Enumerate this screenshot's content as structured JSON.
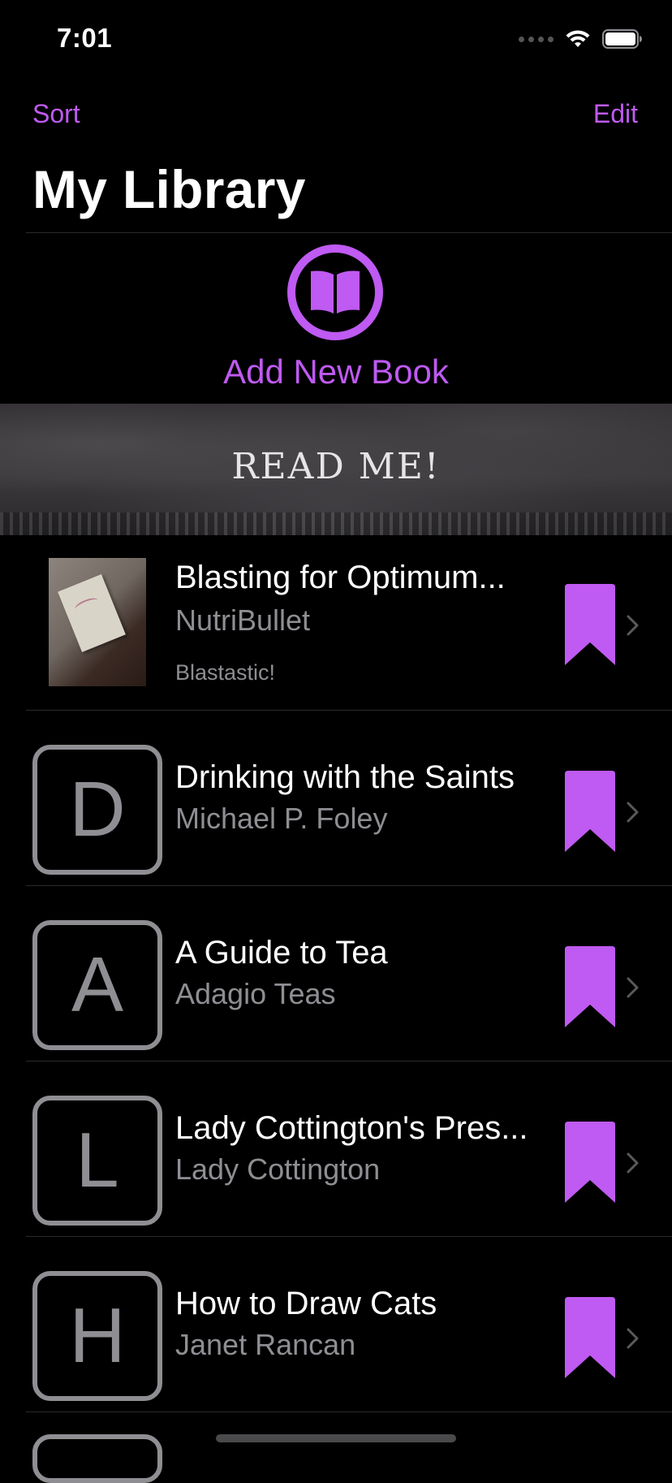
{
  "status_bar": {
    "time": "7:01"
  },
  "nav": {
    "sort_label": "Sort",
    "edit_label": "Edit",
    "title": "My Library"
  },
  "add_book": {
    "label": "Add New Book",
    "icon": "book-open-icon"
  },
  "banner": {
    "text": "READ ME!"
  },
  "books": [
    {
      "title": "Blasting for Optimum...",
      "author": "NutriBullet",
      "note": "Blastastic!",
      "thumbnail": "photo",
      "bookmarked": true
    },
    {
      "title": "Drinking with the Saints",
      "author": "Michael P. Foley",
      "thumbnail_letter": "D",
      "bookmarked": true
    },
    {
      "title": "A Guide to Tea",
      "author": "Adagio Teas",
      "thumbnail_letter": "A",
      "bookmarked": true
    },
    {
      "title": "Lady Cottington's Pres...",
      "author": "Lady Cottington",
      "thumbnail_letter": "L",
      "bookmarked": true
    },
    {
      "title": "How to Draw Cats",
      "author": "Janet Rancan",
      "thumbnail_letter": "H",
      "bookmarked": true
    }
  ],
  "colors": {
    "accent": "#bf5af2",
    "secondary_text": "#8e8e93",
    "background": "#000000"
  }
}
